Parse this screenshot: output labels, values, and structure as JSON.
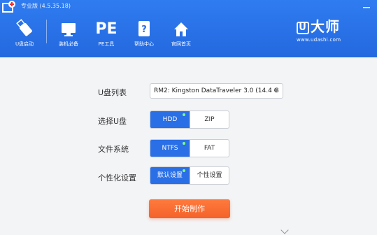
{
  "titlebar": {
    "title": "专业版 (4.5.35.18)"
  },
  "nav": {
    "items": [
      {
        "label": "U盘启动"
      },
      {
        "label": "装机必备"
      },
      {
        "label": "PE工具",
        "icon_text": "PE"
      },
      {
        "label": "帮助中心"
      },
      {
        "label": "官网首页"
      }
    ]
  },
  "logo": {
    "brand": "大师",
    "brand_letter": "U",
    "url": "www.udashi.com"
  },
  "form": {
    "usb_list_label": "U盘列表",
    "usb_selected": "RM2: Kingston DataTraveler 3.0 (14.4 G",
    "choose_usb_label": "选择U盘",
    "choose_usb_options": [
      {
        "label": "HDD",
        "active": true
      },
      {
        "label": "ZIP",
        "active": false
      }
    ],
    "filesystem_label": "文件系统",
    "filesystem_options": [
      {
        "label": "NTFS",
        "active": true
      },
      {
        "label": "FAT",
        "active": false
      }
    ],
    "personalize_label": "个性化设置",
    "personalize_options": [
      {
        "label": "默认设置",
        "active": true
      },
      {
        "label": "个性设置",
        "active": false
      }
    ],
    "start_button": "开始制作"
  },
  "colors": {
    "header_blue": "#2a6fe6",
    "accent_orange": "#f4622a",
    "active_dot": "#7dff7d"
  }
}
